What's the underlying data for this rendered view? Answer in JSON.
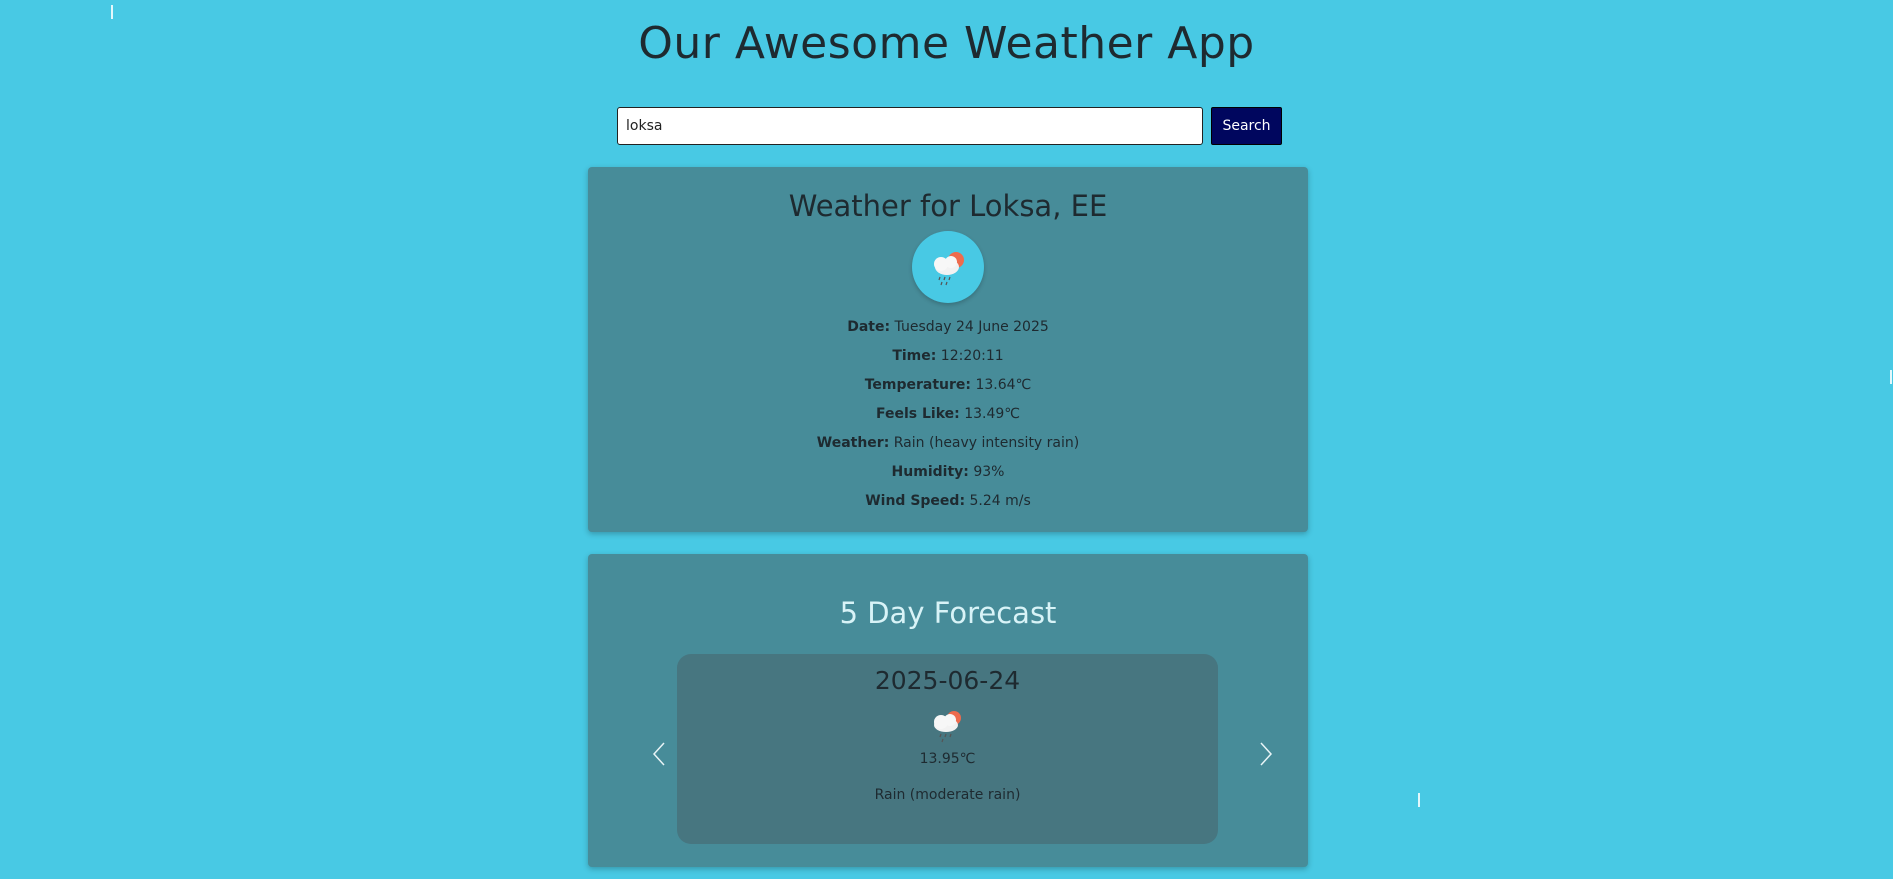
{
  "app": {
    "title": "Our Awesome Weather App"
  },
  "search": {
    "value": "loksa",
    "button_label": "Search"
  },
  "current": {
    "title": "Weather for Loksa, EE",
    "icon": "rain-cloud-sun-icon",
    "details": [
      {
        "label": "Date:",
        "value": "Tuesday 24 June 2025"
      },
      {
        "label": "Time:",
        "value": "12:20:11"
      },
      {
        "label": "Temperature:",
        "value": "13.64℃"
      },
      {
        "label": "Feels Like:",
        "value": "13.49℃"
      },
      {
        "label": "Weather:",
        "value": "Rain (heavy intensity rain)"
      },
      {
        "label": "Humidity:",
        "value": "93%"
      },
      {
        "label": "Wind Speed:",
        "value": "5.24 m/s"
      }
    ]
  },
  "forecast": {
    "title": "5 Day Forecast",
    "slide": {
      "date": "2025-06-24",
      "icon": "rain-cloud-sun-icon",
      "temperature": "13.95℃",
      "description": "Rain (moderate rain)"
    }
  },
  "colors": {
    "background": "#48c9e4",
    "card": "#478c99",
    "slide": "#477680",
    "search_button": "#00065e"
  }
}
